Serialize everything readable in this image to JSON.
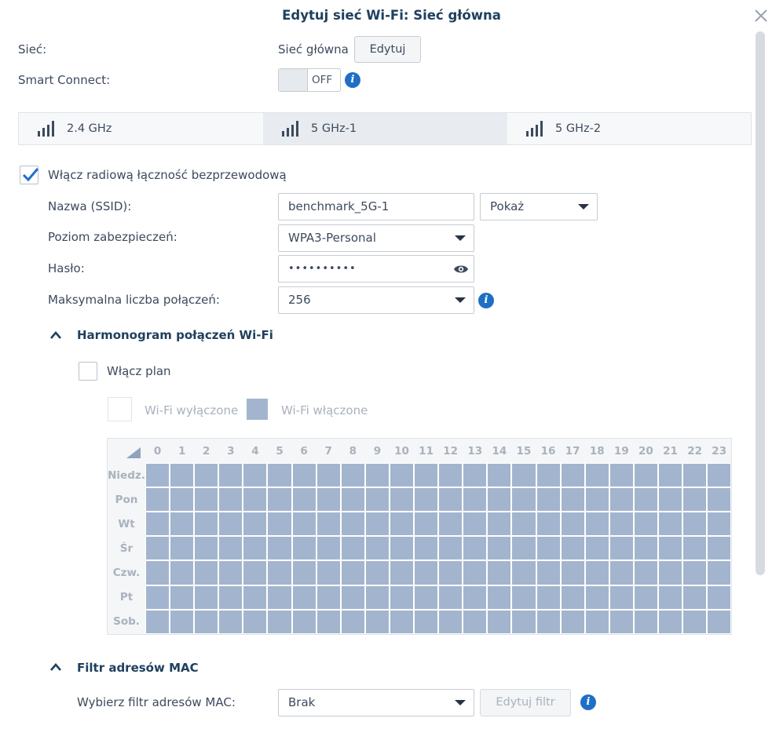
{
  "dialog": {
    "title": "Edytuj sieć Wi-Fi: Sieć główna"
  },
  "network": {
    "label": "Sieć:",
    "value": "Sieć główna",
    "edit_button": "Edytuj"
  },
  "smart_connect": {
    "label": "Smart Connect:",
    "state": "OFF"
  },
  "bands": [
    {
      "label": "2.4 GHz",
      "active": false
    },
    {
      "label": "5 GHz-1",
      "active": true
    },
    {
      "label": "5 GHz-2",
      "active": false
    }
  ],
  "wireless": {
    "enable_label": "Włącz radiową łączność bezprzewodową",
    "enabled": true,
    "ssid_label": "Nazwa (SSID):",
    "ssid_value": "benchmark_5G-1",
    "ssid_visibility": "Pokaż",
    "security_label": "Poziom zabezpieczeń:",
    "security_value": "WPA3-Personal",
    "password_label": "Hasło:",
    "password_value": "••••••••••",
    "max_conn_label": "Maksymalna liczba połączeń:",
    "max_conn_value": "256"
  },
  "schedule": {
    "heading": "Harmonogram połączeń Wi-Fi",
    "enable_label": "Włącz plan",
    "enabled": false,
    "legend_off": "Wi-Fi wyłączone",
    "legend_on": "Wi-Fi włączone",
    "hours": [
      "0",
      "1",
      "2",
      "3",
      "4",
      "5",
      "6",
      "7",
      "8",
      "9",
      "10",
      "11",
      "12",
      "13",
      "14",
      "15",
      "16",
      "17",
      "18",
      "19",
      "20",
      "21",
      "22",
      "23"
    ],
    "days": [
      "Niedz.",
      "Pon",
      "Wt",
      "Śr",
      "Czw.",
      "Pt",
      "Sob."
    ],
    "on_color": "#a3b5ce"
  },
  "mac_filter": {
    "heading": "Filtr adresów MAC",
    "select_label": "Wybierz filtr adresów MAC:",
    "select_value": "Brak",
    "edit_button": "Edytuj filtr"
  },
  "colors": {
    "accent": "#1f6fc5",
    "heading": "#20405e"
  }
}
